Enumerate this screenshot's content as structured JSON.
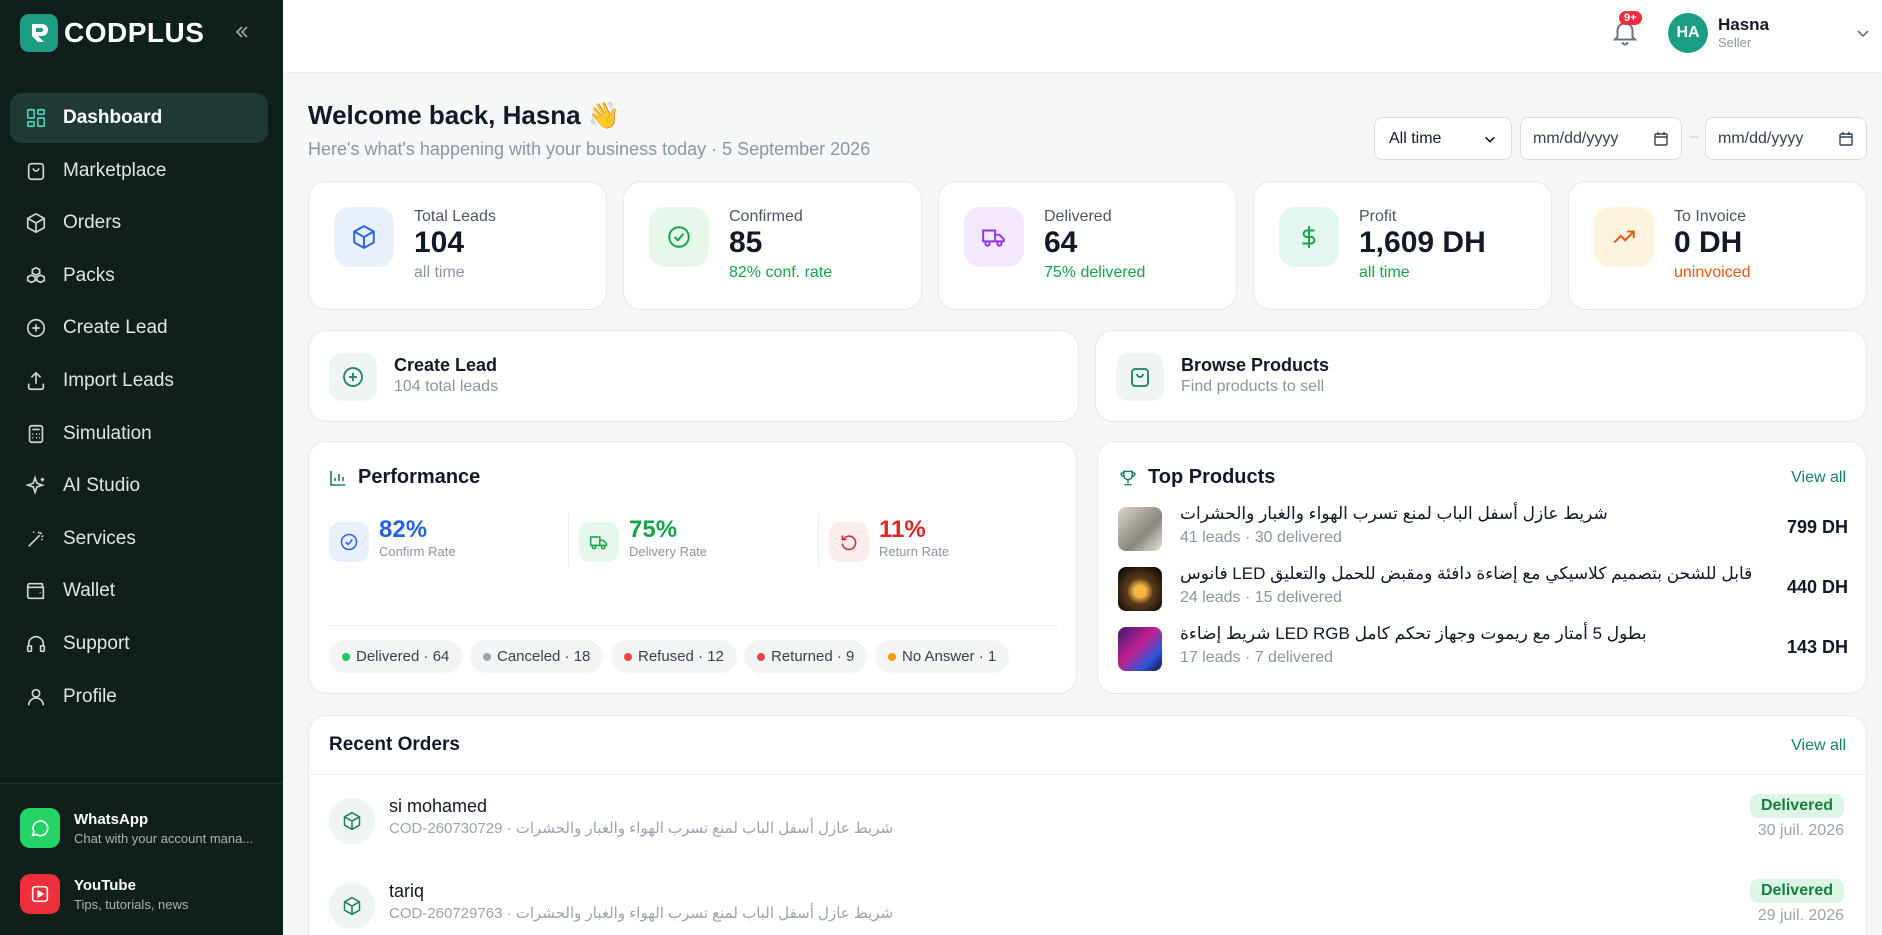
{
  "brand": {
    "name": "CODPLUS"
  },
  "nav": [
    {
      "label": "Dashboard",
      "icon": "dashboard-icon"
    },
    {
      "label": "Marketplace",
      "icon": "shopping-bag-icon"
    },
    {
      "label": "Orders",
      "icon": "box-icon"
    },
    {
      "label": "Packs",
      "icon": "boxes-icon"
    },
    {
      "label": "Create Lead",
      "icon": "plus-circle-icon"
    },
    {
      "label": "Import Leads",
      "icon": "upload-icon"
    },
    {
      "label": "Simulation",
      "icon": "calculator-icon"
    },
    {
      "label": "AI Studio",
      "icon": "sparkles-icon"
    },
    {
      "label": "Services",
      "icon": "magic-wand-icon"
    },
    {
      "label": "Wallet",
      "icon": "wallet-icon"
    },
    {
      "label": "Support",
      "icon": "headset-icon"
    },
    {
      "label": "Profile",
      "icon": "user-icon"
    }
  ],
  "footer": {
    "whatsapp": {
      "title": "WhatsApp",
      "subtitle": "Chat with your account mana..."
    },
    "youtube": {
      "title": "YouTube",
      "subtitle": "Tips, tutorials, news"
    }
  },
  "header": {
    "notif_badge": "9+",
    "user_initials": "HA",
    "user_name": "Hasna",
    "user_role": "Seller"
  },
  "welcome": {
    "title": "Welcome back, Hasna 👋",
    "subtitle": "Here's what's happening with your business today · 5 September 2026"
  },
  "filters": {
    "period": "All time",
    "date_from_placeholder": "mm/dd/yyyy",
    "date_to_placeholder": "mm/dd/yyyy"
  },
  "stats": [
    {
      "label": "Total Leads",
      "value": "104",
      "note": "all time",
      "color": "#2563eb",
      "bg": "#e8f0fe",
      "note_color": "#8b95a3"
    },
    {
      "label": "Confirmed",
      "value": "85",
      "note": "82% conf. rate",
      "color": "#16a34a",
      "bg": "#e6f7ec",
      "note_color": "#16a34a"
    },
    {
      "label": "Delivered",
      "value": "64",
      "note": "75% delivered",
      "color": "#9333ea",
      "bg": "#f3e8ff",
      "note_color": "#16a34a"
    },
    {
      "label": "Profit",
      "value": "1,609 DH",
      "note": "all time",
      "color": "#16a34a",
      "bg": "#e3f7ee",
      "note_color": "#16a34a"
    },
    {
      "label": "To Invoice",
      "value": "0 DH",
      "note": "uninvoiced",
      "color": "#ea580c",
      "bg": "#fff3e0",
      "note_color": "#ea580c"
    }
  ],
  "actions": [
    {
      "title": "Create Lead",
      "subtitle": "104 total leads"
    },
    {
      "title": "Browse Products",
      "subtitle": "Find products to sell"
    }
  ],
  "performance": {
    "title": "Performance",
    "metrics": [
      {
        "value": "82%",
        "label": "Confirm Rate",
        "color": "#2563eb"
      },
      {
        "value": "75%",
        "label": "Delivery Rate",
        "color": "#16a34a"
      },
      {
        "value": "11%",
        "label": "Return Rate",
        "color": "#dc2626"
      }
    ],
    "statuses": [
      {
        "label": "Delivered · 64",
        "color": "#22c55e"
      },
      {
        "label": "Canceled · 18",
        "color": "#9ca3af"
      },
      {
        "label": "Refused · 12",
        "color": "#ef4444"
      },
      {
        "label": "Returned · 9",
        "color": "#ef4444"
      },
      {
        "label": "No Answer · 1",
        "color": "#f59e0b"
      }
    ]
  },
  "top_products": {
    "title": "Top Products",
    "view_all": "View all",
    "items": [
      {
        "name": "شريط عازل أسفل الباب لمنع تسرب الهواء والغبار والحشرات",
        "meta": "41 leads · 30 delivered",
        "price": "799 DH"
      },
      {
        "name": "فانوس LED قابل للشحن بتصميم كلاسيكي مع إضاءة دافئة ومقبض للحمل والتعليق",
        "meta": "24 leads · 15 delivered",
        "price": "440 DH"
      },
      {
        "name": "شريط إضاءة LED RGB بطول 5 أمتار مع ريموت وجهاز تحكم كامل",
        "meta": "17 leads · 7 delivered",
        "price": "143 DH"
      }
    ]
  },
  "recent_orders": {
    "title": "Recent Orders",
    "view_all": "View all",
    "items": [
      {
        "name": "si mohamed",
        "meta": "COD-260730729 · شريط عازل أسفل الباب لمنع تسرب الهواء والغبار والحشرات",
        "status": "Delivered",
        "date": "30 juil. 2026"
      },
      {
        "name": "tariq",
        "meta": "COD-260729763 · شريط عازل أسفل الباب لمنع تسرب الهواء والغبار والحشرات",
        "status": "Delivered",
        "date": "29 juil. 2026"
      }
    ]
  }
}
